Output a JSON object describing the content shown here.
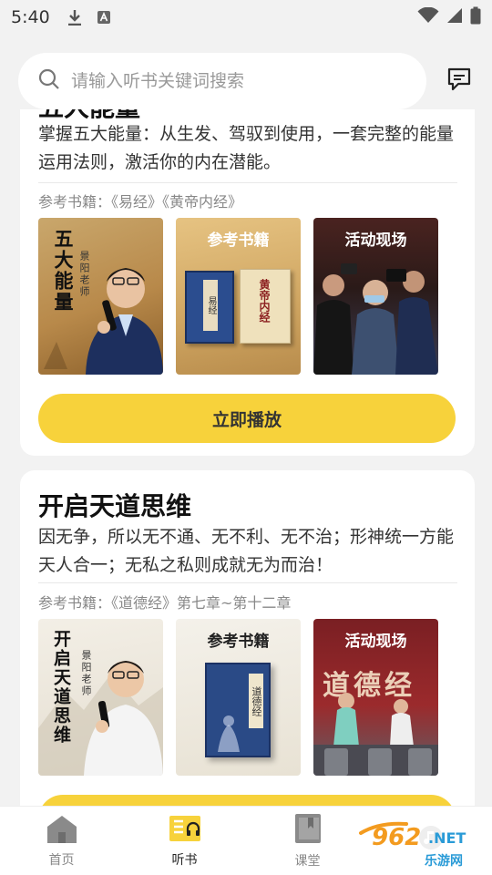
{
  "status": {
    "time": "5:40"
  },
  "search": {
    "placeholder": "请输入听书关键词搜索"
  },
  "cards": [
    {
      "title": "五大能量",
      "desc": "掌握五大能量：从生发、驾驭到使用，一套完整的能量运用法则，激活你的内在潜能。",
      "ref": "参考书籍：《易经》《黄帝内经》",
      "thumbs": [
        {
          "title": "五大能量",
          "teacher": "景阳老师"
        },
        {
          "heading": "参考书籍",
          "book1": "易经",
          "book2": "黄帝内经"
        },
        {
          "heading": "活动现场"
        }
      ],
      "button": "立即播放"
    },
    {
      "title": "开启天道思维",
      "desc": "因无争，所以无不通、无不利、无不治；形神统一方能天人合一；无私之私则成就无为而治！",
      "ref": "参考书籍：《道德经》第七章~第十二章",
      "thumbs": [
        {
          "title": "开启天道思维",
          "teacher": "景阳老师"
        },
        {
          "heading": "参考书籍",
          "book1": "道德经"
        },
        {
          "heading": "活动现场",
          "banner": "道德经"
        }
      ]
    }
  ],
  "tabs": [
    {
      "label": "首页"
    },
    {
      "label": "听书"
    },
    {
      "label": "课堂"
    },
    {
      "label": ""
    }
  ],
  "watermark": {
    "num": "962",
    "net": ".NET",
    "cn": "乐游网"
  },
  "colors": {
    "accent": "#f7d23b",
    "background": "#f2f2f2",
    "card": "#ffffff"
  }
}
